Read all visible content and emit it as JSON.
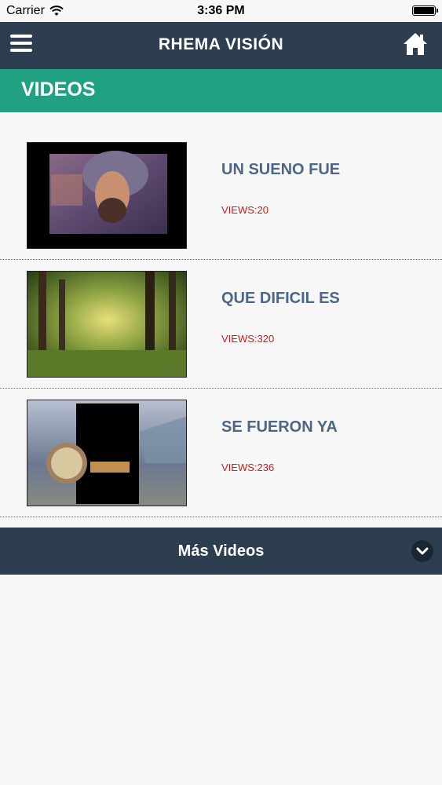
{
  "status_bar": {
    "carrier": "Carrier",
    "time": "3:36 PM"
  },
  "header": {
    "title": "RHEMA VISIÓN",
    "menu_icon": "hamburger-icon",
    "home_icon": "home-icon"
  },
  "section": {
    "title": "VIDEOS"
  },
  "videos": [
    {
      "title": "UN SUENO FUE",
      "views": "VIEWS:20"
    },
    {
      "title": "QUE DIFICIL ES",
      "views": "VIEWS:320"
    },
    {
      "title": "SE FUERON YA",
      "views": "VIEWS:236"
    }
  ],
  "more": {
    "label": "Más Videos",
    "icon": "chevron-down-icon"
  },
  "colors": {
    "navbar": "#2c3e50",
    "section": "#1fa182",
    "title_text": "#4d6685",
    "views_text": "#d01a1a"
  }
}
